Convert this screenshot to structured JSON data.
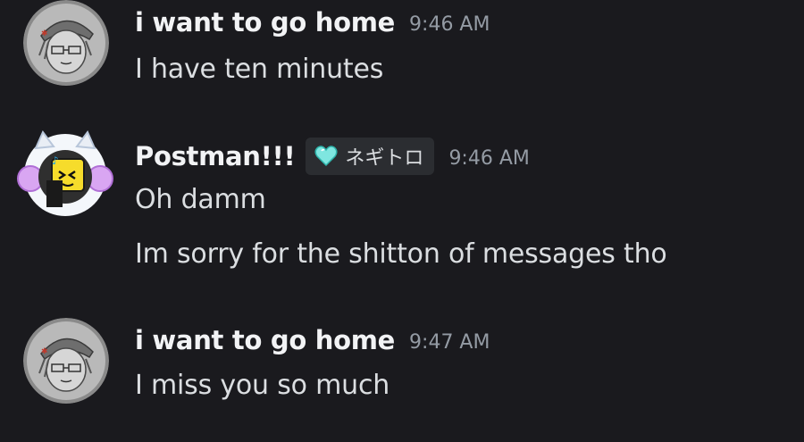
{
  "messages": [
    {
      "username": "i want to go home",
      "timestamp": "9:46 AM",
      "lines": [
        "I have ten minutes"
      ],
      "avatar": "sketch-avatar-icon"
    },
    {
      "username": "Postman!!!",
      "tag": "ネギトロ",
      "tag_icon": "cyan-heart-icon",
      "timestamp": "9:46 AM",
      "lines": [
        "Oh damm",
        "Im sorry for the shitton of messages tho"
      ],
      "avatar": "cat-headphones-avatar-icon"
    },
    {
      "username": "i want to go home",
      "timestamp": "9:47 AM",
      "lines": [
        "I miss you so much"
      ],
      "avatar": "sketch-avatar-icon"
    }
  ],
  "colors": {
    "background": "#1a1a1e",
    "username": "#f2f3f5",
    "message_text": "#dbdee1",
    "timestamp": "#949ba4",
    "tag_background": "#2b2d31",
    "heart": "#7fe6e0"
  }
}
